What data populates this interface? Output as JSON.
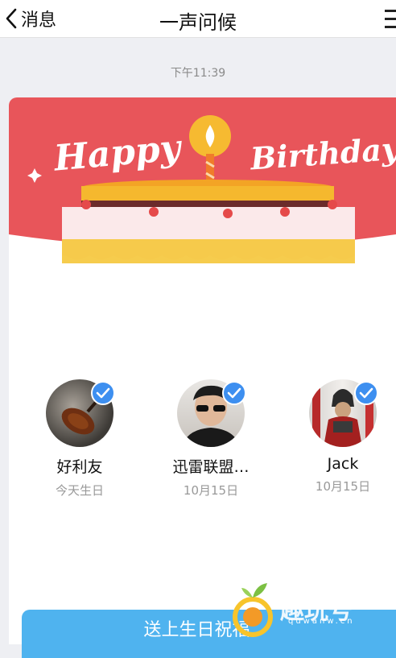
{
  "header": {
    "back_label": "消息",
    "title": "一声问候"
  },
  "timestamp": "下午11:39",
  "banner": {
    "greeting_word1": "Happy",
    "greeting_word2": "Birthday",
    "colors": {
      "background": "#e8555a",
      "cake_top": "#f5b82e",
      "cake_icing": "#fbe9ea"
    }
  },
  "friends": [
    {
      "name": "好利友",
      "date": "今天生日",
      "avatar": "violin-photo",
      "selected": true
    },
    {
      "name": "迅雷联盟…",
      "date": "10月15日",
      "avatar": "man-sunglasses-photo",
      "selected": true
    },
    {
      "name": "Jack",
      "date": "10月15日",
      "avatar": "samurai-photo",
      "selected": true
    }
  ],
  "send_button": "送上生日祝福",
  "watermark": {
    "text": "趣玩号",
    "url": "quwanw.cn"
  },
  "accent_color": "#3d8ff0"
}
